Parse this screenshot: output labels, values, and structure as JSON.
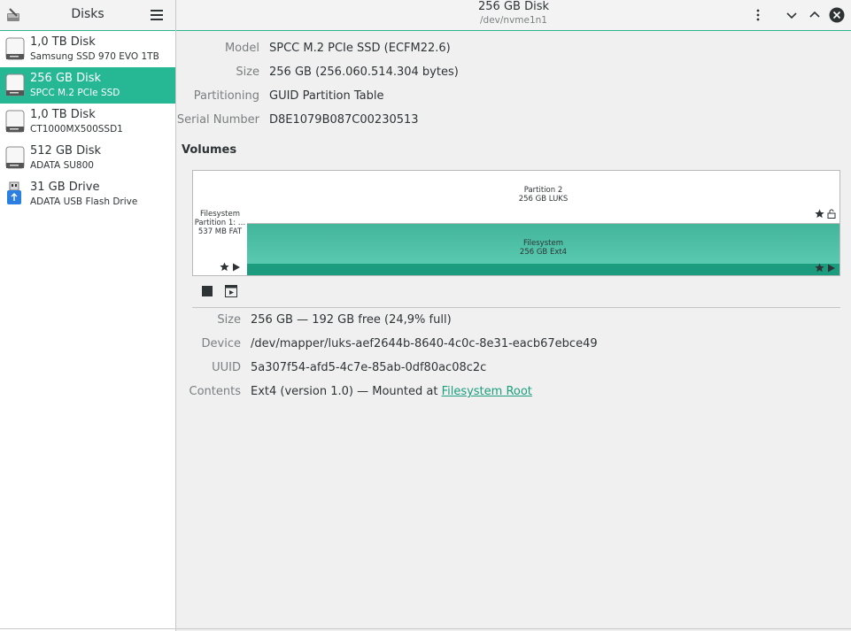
{
  "sidebar": {
    "title": "Disks",
    "items": [
      {
        "name": "1,0 TB Disk",
        "model": "Samsung SSD 970 EVO 1TB",
        "icon": "hard-disk-icon"
      },
      {
        "name": "256 GB Disk",
        "model": "SPCC M.2 PCIe SSD",
        "icon": "hard-disk-icon",
        "selected": true
      },
      {
        "name": "1,0 TB Disk",
        "model": "CT1000MX500SSD1",
        "icon": "hard-disk-icon"
      },
      {
        "name": "512 GB Disk",
        "model": "ADATA SU800",
        "icon": "hard-disk-icon"
      },
      {
        "name": "31 GB Drive",
        "model": "ADATA USB Flash Drive",
        "icon": "usb-drive-icon"
      }
    ]
  },
  "header": {
    "title": "256 GB Disk",
    "subtitle": "/dev/nvme1n1"
  },
  "disk_info": {
    "model_label": "Model",
    "model_value": "SPCC M.2 PCIe SSD (ECFM22.6)",
    "size_label": "Size",
    "size_value": "256 GB (256.060.514.304 bytes)",
    "partitioning_label": "Partitioning",
    "partitioning_value": "GUID Partition Table",
    "serial_label": "Serial Number",
    "serial_value": "D8E1079B087C00230513"
  },
  "volumes": {
    "title": "Volumes",
    "partition1": {
      "line1": "Filesystem",
      "line2": "Partition 1: …",
      "line3": "537 MB FAT"
    },
    "partition2": {
      "line1": "Partition 2",
      "line2": "256 GB LUKS"
    },
    "filesystem": {
      "line1": "Filesystem",
      "line2": "256 GB Ext4"
    }
  },
  "volume_info": {
    "size_label": "Size",
    "size_value": "256 GB — 192 GB free (24,9% full)",
    "device_label": "Device",
    "device_value": "/dev/mapper/luks-aef2644b-8640-4c0c-8e31-eacb67ebce49",
    "uuid_label": "UUID",
    "uuid_value": "5a307f54-afd5-4c7e-85ab-0df80ac08c2c",
    "contents_label": "Contents",
    "contents_prefix": "Ext4 (version 1.0) — Mounted at ",
    "contents_link": "Filesystem Root"
  },
  "colors": {
    "accent": "#26b794",
    "filesystem_fill": "#5fd0b6",
    "link": "#1b9e7d"
  }
}
